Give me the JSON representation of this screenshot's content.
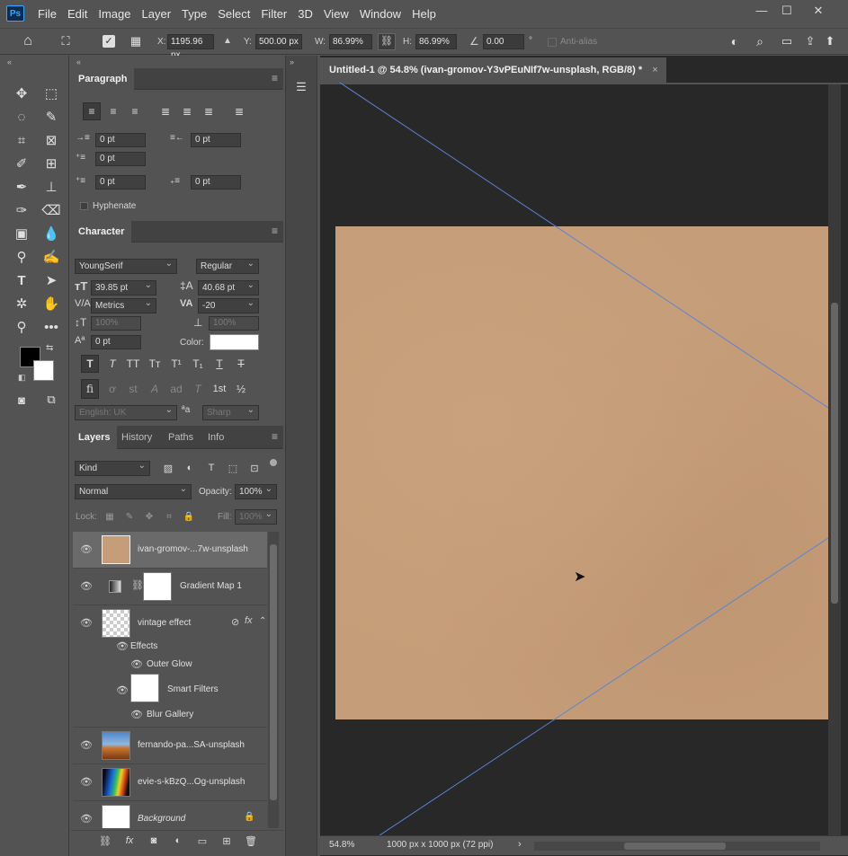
{
  "app": {
    "logo": "Ps"
  },
  "menu": [
    "File",
    "Edit",
    "Image",
    "Layer",
    "Type",
    "Select",
    "Filter",
    "3D",
    "View",
    "Window",
    "Help"
  ],
  "window_controls": {
    "minimize": "—",
    "maximize": "☐",
    "close": "✕"
  },
  "options": {
    "x_label": "X:",
    "x_value": "1195.96 px",
    "y_label": "Y:",
    "y_value": "500.00 px",
    "w_label": "W:",
    "w_value": "86.99%",
    "h_label": "H:",
    "h_value": "86.99%",
    "angle_value": "0.00",
    "angle_unit": "°",
    "antialias_label": "Anti-alias"
  },
  "paragraph_panel": {
    "title": "Paragraph",
    "indent_left": "0 pt",
    "indent_right": "0 pt",
    "indent_first": "0 pt",
    "space_before": "0 pt",
    "space_after": "0 pt",
    "hyphenate_label": "Hyphenate"
  },
  "character_panel": {
    "title": "Character",
    "font_family": "YoungSerif",
    "font_style": "Regular",
    "font_size": "39.85 pt",
    "leading": "40.68 pt",
    "kerning": "Metrics",
    "tracking": "-20",
    "vscale": "100%",
    "hscale": "100%",
    "baseline": "0 pt",
    "color_label": "Color:",
    "language": "English: UK",
    "aa_icon": "ªa",
    "antialias": "Sharp",
    "color_swatch": "#ffffff",
    "style_buttons": [
      "T",
      "T",
      "TT",
      "Tт",
      "T¹",
      "T₁",
      "T",
      "T"
    ],
    "ot_buttons": [
      "fi",
      "ơ",
      "st",
      "A",
      "ad",
      "T",
      "1st",
      "½"
    ]
  },
  "layers_panel": {
    "tabs": [
      "Layers",
      "History",
      "Paths",
      "Info"
    ],
    "kind_placeholder": "Kind",
    "blend_mode": "Normal",
    "opacity_label": "Opacity:",
    "opacity_value": "100%",
    "lock_label": "Lock:",
    "fill_label": "Fill:",
    "fill_value": "100%",
    "layers": [
      {
        "name": "ivan-gromov-...7w-unsplash"
      },
      {
        "name": "Gradient Map 1"
      },
      {
        "name": "vintage effect",
        "fx": "fx"
      },
      {
        "name": "Effects"
      },
      {
        "name": "Outer Glow"
      },
      {
        "name": "Smart Filters"
      },
      {
        "name": "Blur Gallery"
      },
      {
        "name": "fernando-pa...SA-unsplash"
      },
      {
        "name": "evie-s-kBzQ...Og-unsplash"
      },
      {
        "name": "Background"
      }
    ]
  },
  "document": {
    "tab_title": "Untitled-1 @ 54.8% (ivan-gromov-Y3vPEuNIf7w-unsplash, RGB/8) *",
    "tab_close": "×",
    "zoom": "54.8%",
    "doc_info": "1000 px x 1000 px (72 ppi)",
    "status_arrow": "›"
  },
  "colors": {
    "paper": "#c59d78",
    "canvas_bg": "#282828",
    "guide": "#5b84d6",
    "ui_bg": "#535353"
  }
}
